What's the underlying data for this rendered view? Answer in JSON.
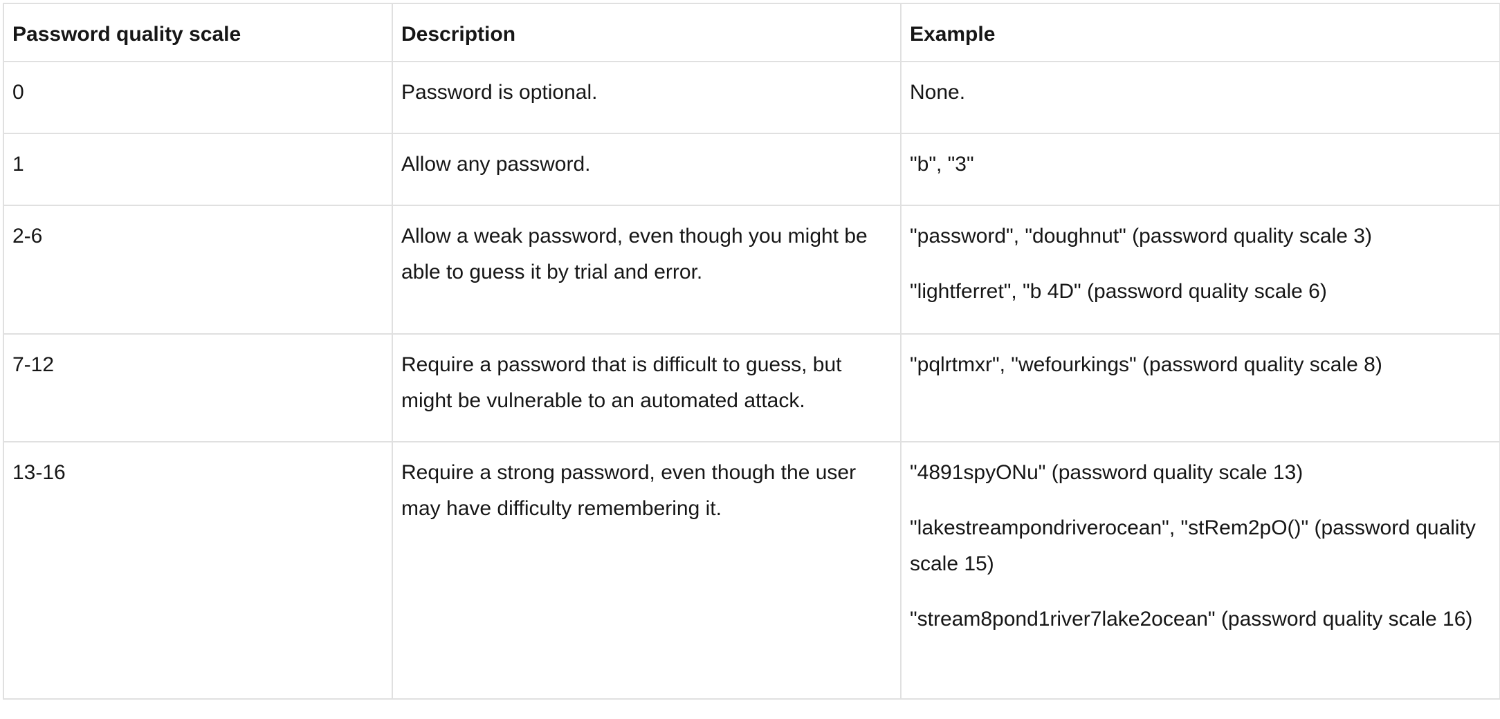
{
  "table": {
    "headers": [
      "Password quality scale",
      "Description",
      "Example"
    ],
    "rows": [
      {
        "scale": "0",
        "description": "Password is optional.",
        "examples": [
          "None."
        ]
      },
      {
        "scale": "1",
        "description": "Allow any password.",
        "examples": [
          "\"b\", \"3\""
        ]
      },
      {
        "scale": "2-6",
        "description": "Allow a weak password, even though you might be able to guess it by trial and error.",
        "examples": [
          "\"password\", \"doughnut\" (password quality scale 3)",
          "\"lightferret\", \"b 4D\" (password quality scale 6)"
        ]
      },
      {
        "scale": "7-12",
        "description": "Require a password that is difficult to guess, but might be vulnerable to an automated attack.",
        "examples": [
          "\"pqlrtmxr\", \"wefourkings\" (password quality scale 8)"
        ]
      },
      {
        "scale": "13-16",
        "description": "Require a strong password, even though the user may have difficulty remembering it.",
        "examples": [
          "\"4891spyONu\" (password quality scale 13)",
          "\"lakestreampondriverocean\", \"stRem2pO()\" (password quality scale 15)",
          "\"stream8pond1river7lake2ocean\" (password quality scale 16)"
        ]
      }
    ]
  }
}
